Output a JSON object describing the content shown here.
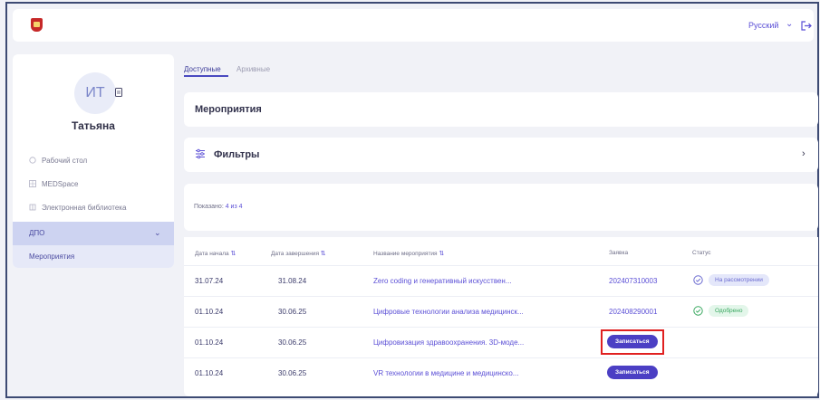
{
  "header": {
    "language": "Русский",
    "icons": {
      "logo": "app-logo-icon",
      "lang_dropdown": "chevron-down-icon",
      "logout": "logout-icon"
    }
  },
  "sidebar": {
    "avatar_initials": "ИТ",
    "user_name": "Татьяна",
    "items": [
      {
        "label": "Рабочий стол",
        "icon": "home-icon"
      },
      {
        "label": "MEDSpace",
        "icon": "grid-icon"
      },
      {
        "label": "Электронная библиотека",
        "icon": "book-icon"
      },
      {
        "label": "ДПО",
        "icon": "chevron-down-icon"
      },
      {
        "label": "Мероприятия"
      }
    ]
  },
  "tabs": [
    {
      "label": "Доступные",
      "active": true
    },
    {
      "label": "Архивные",
      "active": false
    }
  ],
  "events_card": {
    "title": "Мероприятия"
  },
  "filters_card": {
    "title": "Фильтры"
  },
  "shown": {
    "label": "Показано:",
    "count": "4 из 4"
  },
  "table": {
    "columns": [
      "Дата начала",
      "Дата завершения",
      "Название мероприятия",
      "Заявка",
      "Статус"
    ],
    "rows": [
      {
        "start": "31.07.24",
        "end": "31.08.24",
        "title": "Zero coding и генеративный искусствен...",
        "application": "202407310003",
        "status": "На рассмотрении",
        "status_type": "review"
      },
      {
        "start": "01.10.24",
        "end": "30.06.25",
        "title": "Цифровые технологии анализа медицинск...",
        "application": "202408290001",
        "status": "Одобрено",
        "status_type": "approved"
      },
      {
        "start": "01.10.24",
        "end": "30.06.25",
        "title": "Цифровизация здравоохранения. 3D-моде...",
        "button": "Записаться",
        "highlighted": true
      },
      {
        "start": "01.10.24",
        "end": "30.06.25",
        "title": "VR технологии в медицине и медицинско...",
        "button": "Записаться"
      }
    ]
  },
  "colors": {
    "accent": "#4b3fc4",
    "highlight": "#e02020",
    "sidebar_active": "#cdd3f1"
  }
}
